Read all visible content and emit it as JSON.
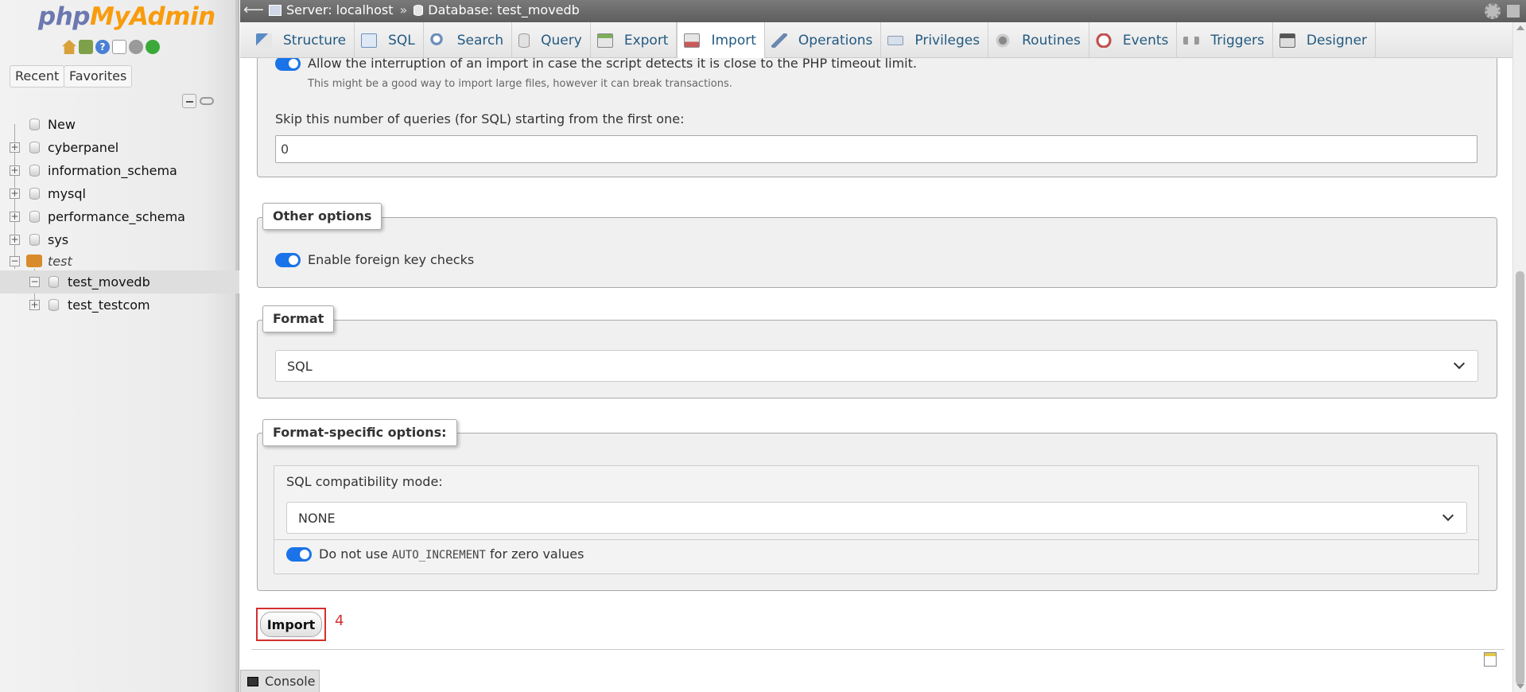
{
  "app": {
    "logo_php": "php",
    "logo_my": "My",
    "logo_admin": "Admin"
  },
  "sidebar": {
    "recent_label": "Recent",
    "favorites_label": "Favorites",
    "tree": [
      {
        "label": "New",
        "level": 0
      },
      {
        "label": "cyberpanel",
        "level": 0
      },
      {
        "label": "information_schema",
        "level": 0
      },
      {
        "label": "mysql",
        "level": 0
      },
      {
        "label": "performance_schema",
        "level": 0
      },
      {
        "label": "sys",
        "level": 0
      },
      {
        "label": "test",
        "level": 0
      },
      {
        "label": "test_movedb",
        "level": 1
      },
      {
        "label": "test_testcom",
        "level": 1
      }
    ]
  },
  "topbar": {
    "server_label": "Server: localhost",
    "separator": "»",
    "database_label": "Database: test_movedb"
  },
  "tabs": [
    {
      "label": "Structure",
      "icon": "structure-icon"
    },
    {
      "label": "SQL",
      "icon": "sql-icon"
    },
    {
      "label": "Search",
      "icon": "search-icon"
    },
    {
      "label": "Query",
      "icon": "query-icon"
    },
    {
      "label": "Export",
      "icon": "export-icon"
    },
    {
      "label": "Import",
      "icon": "import-icon",
      "active": true
    },
    {
      "label": "Operations",
      "icon": "operations-icon"
    },
    {
      "label": "Privileges",
      "icon": "privileges-icon"
    },
    {
      "label": "Routines",
      "icon": "routines-icon"
    },
    {
      "label": "Events",
      "icon": "events-icon"
    },
    {
      "label": "Triggers",
      "icon": "triggers-icon"
    },
    {
      "label": "Designer",
      "icon": "designer-icon"
    }
  ],
  "partial_import": {
    "allow_interrupt_label": "Allow the interruption of an import in case the script detects it is close to the PHP timeout limit.",
    "allow_interrupt_note": "This might be a good way to import large files, however it can break transactions.",
    "allow_interrupt_on": true,
    "skip_queries_label": "Skip this number of queries (for SQL) starting from the first one:",
    "skip_queries_value": "0"
  },
  "other_options": {
    "legend": "Other options",
    "fk_checks_label": "Enable foreign key checks",
    "fk_checks_on": true
  },
  "format": {
    "legend": "Format",
    "selected": "SQL"
  },
  "format_specific": {
    "legend": "Format-specific options:",
    "compat_label": "SQL compatibility mode:",
    "compat_selected": "NONE",
    "no_auto_inc_prefix": "Do not use",
    "no_auto_inc_code": "AUTO_INCREMENT",
    "no_auto_inc_suffix": "for zero values",
    "no_auto_inc_on": true
  },
  "actions": {
    "import_label": "Import",
    "annotation": "4"
  },
  "console": {
    "label": "Console"
  },
  "colors": {
    "accent": "#1a73e8",
    "tab_text": "#235a81",
    "annotation": "#d32f2f"
  }
}
